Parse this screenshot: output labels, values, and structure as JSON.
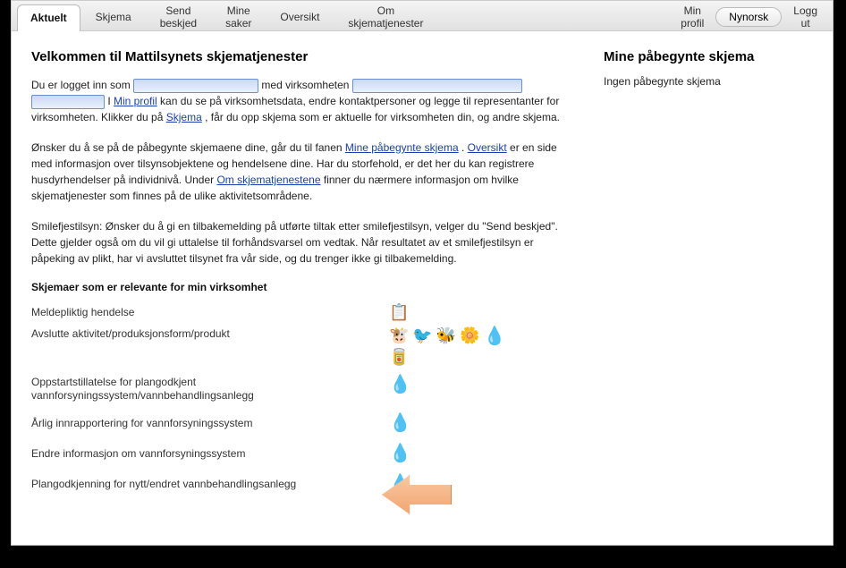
{
  "tabs": {
    "aktuelt": {
      "label": "Aktuelt"
    },
    "skjema": {
      "label": "Skjema"
    },
    "send": {
      "line1": "Send",
      "line2": "beskjed"
    },
    "saker": {
      "line1": "Mine",
      "line2": "saker"
    },
    "oversikt": {
      "label": "Oversikt"
    },
    "om": {
      "line1": "Om",
      "line2": "skjematjenester"
    },
    "profil": {
      "line1": "Min",
      "line2": "profil"
    },
    "nynorsk": {
      "label": "Nynorsk"
    },
    "logout": {
      "line1": "Logg",
      "line2": "ut"
    }
  },
  "welcome_heading": "Velkommen til Mattilsynets skjematjenester",
  "p1": {
    "t1": "Du er logget inn som ",
    "t2": " med virksomheten ",
    "t3": " I ",
    "link_min_profil": "Min profil",
    "t4": " kan du se på virksomhetsdata, endre kontaktpersoner og legge til representanter for virksomheten. Klikker du på ",
    "link_skjema": "Skjema",
    "t5": ", får du opp skjema som er aktuelle for virksomheten din, og andre skjema."
  },
  "p2": {
    "t1": "Ønsker du å se på de påbegynte skjemaene dine, går du til fanen ",
    "link_mpsk": "Mine påbegynte skjema",
    "t2": ". ",
    "link_oversikt": "Oversikt",
    "t3": " er en side med informasjon over tilsynsobjektene og hendelsene dine. Har du storfehold, er det her du kan registrere husdyrhendelser på individnivå. Under ",
    "link_om": "Om skjematjenestene",
    "t4": " finner du nærmere informasjon om hvilke skjematjenester som finnes på de ulike aktivitetsområdene."
  },
  "p3": "Smilefjestilsyn: Ønsker du å gi en tilbakemelding på utførte tiltak etter smilefjestilsyn, velger du \"Send beskjed\". Dette gjelder også om du vil gi uttalelse til forhåndsvarsel om vedtak. Når resultatet av et smilefjestilsyn er påpeking av plikt, har vi avsluttet tilsynet fra vår side, og du trenger ikke gi tilbakemelding.",
  "section_heading": "Skjemaer som er relevante for min virksomhet",
  "forms": {
    "r1": {
      "label": "Meldepliktig hendelse",
      "icons": [
        "📋"
      ]
    },
    "r2": {
      "label": "Avslutte aktivitet/produksjonsform/produkt",
      "icons": [
        "🐮",
        "🐦",
        "🐝",
        "🌼",
        "💧",
        "🥫"
      ]
    },
    "r3": {
      "label": "Oppstartstillatelse for plangodkjent vannforsyningssystem/vannbehandlingsanlegg",
      "icons": [
        "💧"
      ]
    },
    "r4": {
      "label": "Årlig innrapportering for vannforsyningssystem",
      "icons": [
        "💧"
      ]
    },
    "r5": {
      "label": "Endre informasjon om vannforsyningssystem",
      "icons": [
        "💧"
      ]
    },
    "r6": {
      "label": "Plangodkjenning for nytt/endret vannbehandlingsanlegg",
      "icons": [
        "💧"
      ]
    }
  },
  "sidebar": {
    "heading": "Mine påbegynte skjema",
    "empty": "Ingen påbegynte skjema"
  }
}
